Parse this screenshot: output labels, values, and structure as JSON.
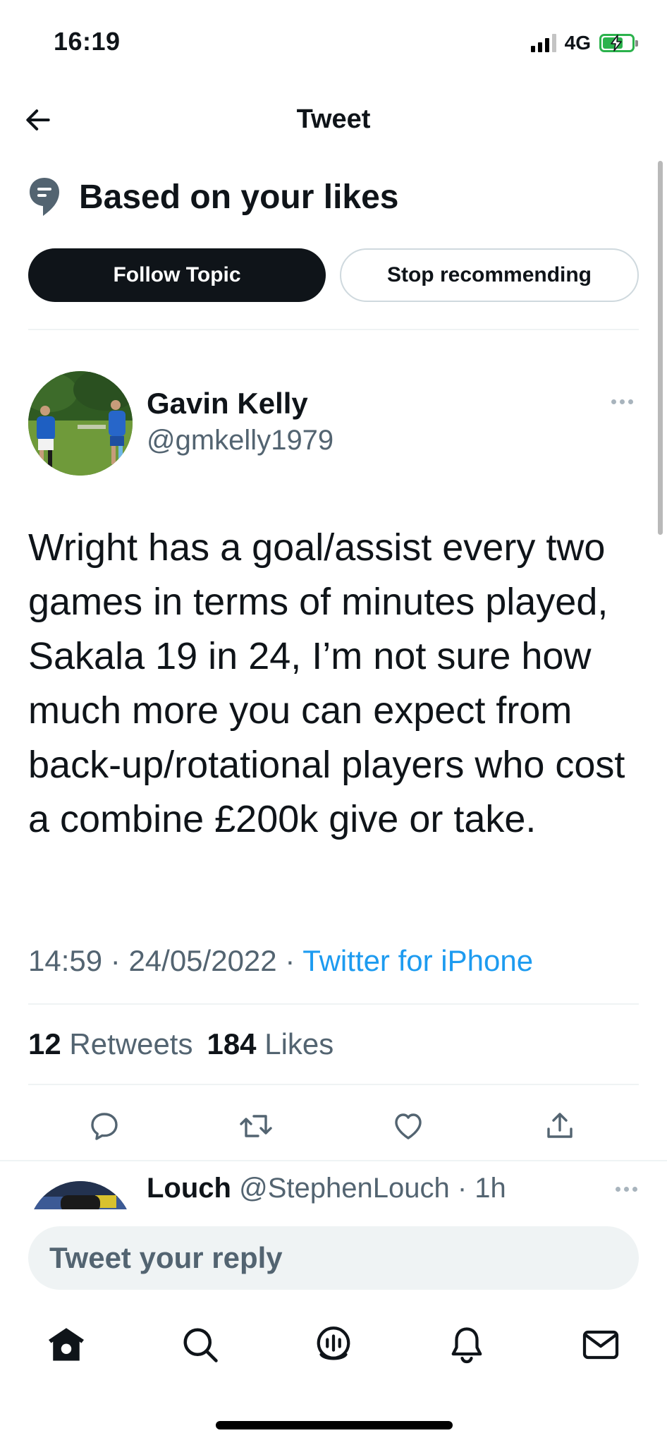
{
  "status_bar": {
    "time": "16:19",
    "network": "4G"
  },
  "nav": {
    "title": "Tweet"
  },
  "topic": {
    "title": "Based on your likes",
    "follow_label": "Follow Topic",
    "stop_label": "Stop recommending"
  },
  "tweet": {
    "author_name": "Gavin Kelly",
    "author_handle": "@gmkelly1979",
    "text": "Wright has a goal/assist every two games in terms of minutes played, Sakala 19 in 24, I’m not sure how much more you can expect from back-up/rotational players who cost a combine £200k give or take.",
    "time": "14:59",
    "date": "24/05/2022",
    "separator": " · ",
    "source": "Twitter for iPhone",
    "retweets_count": "12",
    "retweets_label": "Retweets",
    "likes_count": "184",
    "likes_label": "Likes"
  },
  "reply_preview": {
    "name": "Louch",
    "handle": "@StephenLouch",
    "time": "· 1h"
  },
  "composer": {
    "placeholder": "Tweet your reply"
  },
  "colors": {
    "accent": "#1d9bf0",
    "text": "#0f1419",
    "muted": "#536471",
    "battery": "#2bb24c"
  },
  "icons": {
    "back": "arrow-left-icon",
    "topic": "topic-icon",
    "reply": "reply-icon",
    "retweet": "retweet-icon",
    "like": "heart-icon",
    "share": "share-icon",
    "tabs": [
      "home-icon",
      "search-icon",
      "spaces-icon",
      "notifications-icon",
      "messages-icon"
    ]
  }
}
